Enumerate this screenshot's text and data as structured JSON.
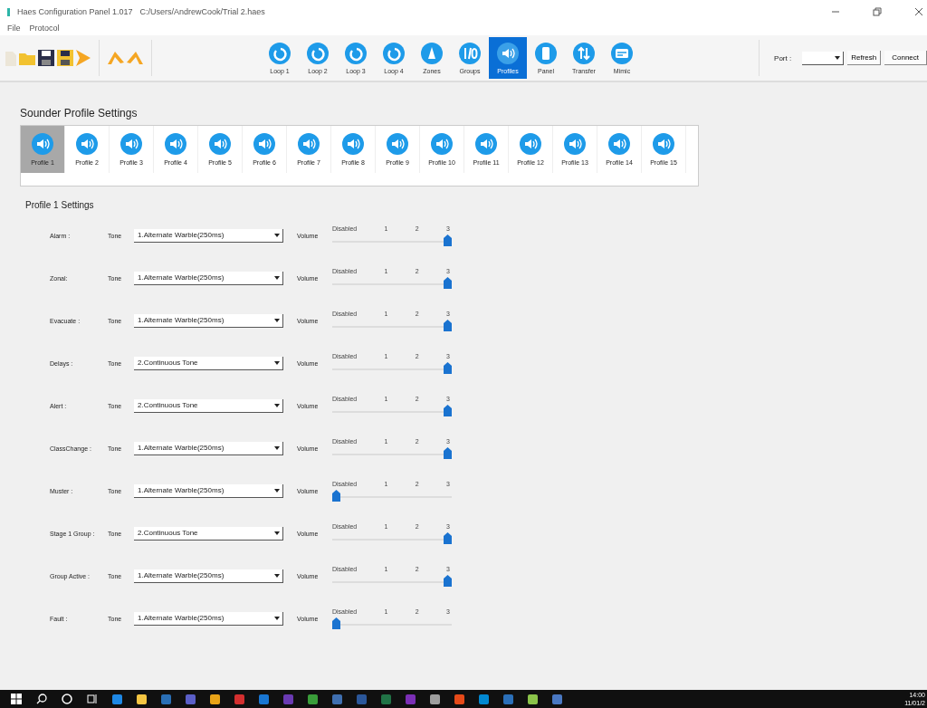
{
  "window": {
    "title": "Haes Configuration Panel 1.017",
    "path": "C:/Users/AndrewCook/Trial 2.haes"
  },
  "menu": [
    "File",
    "Protocol"
  ],
  "nav": [
    {
      "label": "Loop 1",
      "kind": "loop",
      "selected": false
    },
    {
      "label": "Loop 2",
      "kind": "loop",
      "selected": false
    },
    {
      "label": "Loop 3",
      "kind": "loop",
      "selected": false
    },
    {
      "label": "Loop 4",
      "kind": "loop",
      "selected": false
    },
    {
      "label": "Zones",
      "kind": "zones",
      "selected": false
    },
    {
      "label": "Groups",
      "kind": "groups",
      "selected": false
    },
    {
      "label": "Profiles",
      "kind": "speaker",
      "selected": true
    },
    {
      "label": "Panel",
      "kind": "panel",
      "selected": false
    },
    {
      "label": "Transfer",
      "kind": "transfer",
      "selected": false
    },
    {
      "label": "Mimic",
      "kind": "mimic",
      "selected": false
    }
  ],
  "port": {
    "label": "Port :",
    "buttons": [
      "Refresh",
      "Connect"
    ]
  },
  "heading": "Sounder Profile Settings",
  "profiles": [
    {
      "label": "Profile 1",
      "selected": true
    },
    {
      "label": "Profile 2",
      "selected": false
    },
    {
      "label": "Profile 3",
      "selected": false
    },
    {
      "label": "Profile 4",
      "selected": false
    },
    {
      "label": "Profile 5",
      "selected": false
    },
    {
      "label": "Profile 6",
      "selected": false
    },
    {
      "label": "Profile 7",
      "selected": false
    },
    {
      "label": "Profile 8",
      "selected": false
    },
    {
      "label": "Profile 9",
      "selected": false
    },
    {
      "label": "Profile 10",
      "selected": false
    },
    {
      "label": "Profile 11",
      "selected": false
    },
    {
      "label": "Profile 12",
      "selected": false
    },
    {
      "label": "Profile 13",
      "selected": false
    },
    {
      "label": "Profile 14",
      "selected": false
    },
    {
      "label": "Profile 15",
      "selected": false
    }
  ],
  "settings_title": "Profile 1 Settings",
  "rows": [
    {
      "name": "Alarm :",
      "tone_label": "Tone",
      "tone": "1.Alternate Warble(250ms)",
      "volume_label": "Volume",
      "ticks": [
        "Disabled",
        "1",
        "2",
        "3"
      ],
      "level": 1
    },
    {
      "name": "Zonal:",
      "tone_label": "Tone",
      "tone": "1.Alternate Warble(250ms)",
      "volume_label": "Volume",
      "ticks": [
        "Disabled",
        "1",
        "2",
        "3"
      ],
      "level": 1
    },
    {
      "name": "Evacuate :",
      "tone_label": "Tone",
      "tone": "1.Alternate Warble(250ms)",
      "volume_label": "Volume",
      "ticks": [
        "Disabled",
        "1",
        "2",
        "3"
      ],
      "level": 1
    },
    {
      "name": "Delays :",
      "tone_label": "Tone",
      "tone": "2.Continuous Tone",
      "volume_label": "Volume",
      "ticks": [
        "Disabled",
        "1",
        "2",
        "3"
      ],
      "level": 1
    },
    {
      "name": "Alert :",
      "tone_label": "Tone",
      "tone": "2.Continuous Tone",
      "volume_label": "Volume",
      "ticks": [
        "Disabled",
        "1",
        "2",
        "3"
      ],
      "level": 1
    },
    {
      "name": "ClassChange :",
      "tone_label": "Tone",
      "tone": "1.Alternate Warble(250ms)",
      "volume_label": "Volume",
      "ticks": [
        "Disabled",
        "1",
        "2",
        "3"
      ],
      "level": 1
    },
    {
      "name": "Muster :",
      "tone_label": "Tone",
      "tone": "1.Alternate Warble(250ms)",
      "volume_label": "Volume",
      "ticks": [
        "Disabled",
        "1",
        "2",
        "3"
      ],
      "level": 0
    },
    {
      "name": "Stage 1 Group :",
      "tone_label": "Tone",
      "tone": "2.Continuous Tone",
      "volume_label": "Volume",
      "ticks": [
        "Disabled",
        "1",
        "2",
        "3"
      ],
      "level": 1
    },
    {
      "name": "Group Active :",
      "tone_label": "Tone",
      "tone": "1.Alternate Warble(250ms)",
      "volume_label": "Volume",
      "ticks": [
        "Disabled",
        "1",
        "2",
        "3"
      ],
      "level": 1
    },
    {
      "name": "Fault :",
      "tone_label": "Tone",
      "tone": "1.Alternate Warble(250ms)",
      "volume_label": "Volume",
      "ticks": [
        "Disabled",
        "1",
        "2",
        "3"
      ],
      "level": 0
    }
  ],
  "taskbar": {
    "time": "14:00",
    "date": "11/01/2"
  }
}
